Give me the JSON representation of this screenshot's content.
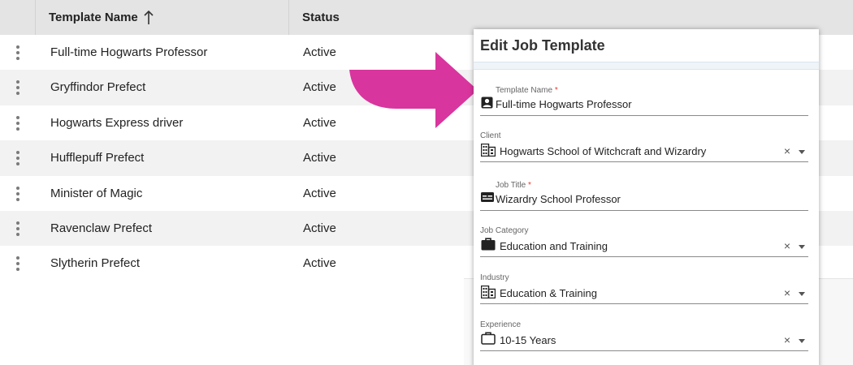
{
  "table": {
    "headers": {
      "name": "Template Name",
      "status": "Status"
    },
    "rows": [
      {
        "name": "Full-time Hogwarts Professor",
        "status": "Active"
      },
      {
        "name": "Gryffindor Prefect",
        "status": "Active"
      },
      {
        "name": "Hogwarts Express driver",
        "status": "Active"
      },
      {
        "name": "Hufflepuff Prefect",
        "status": "Active"
      },
      {
        "name": "Minister of Magic",
        "status": "Active"
      },
      {
        "name": "Ravenclaw Prefect",
        "status": "Active"
      },
      {
        "name": "Slytherin Prefect",
        "status": "Active"
      }
    ]
  },
  "annotation": {
    "arrow_color": "#d9359e"
  },
  "dialog": {
    "title": "Edit Job Template",
    "fields": {
      "template_name": {
        "label": "Template Name",
        "required": "*",
        "value": "Full-time Hogwarts Professor",
        "icon": "person-badge-icon"
      },
      "client": {
        "label": "Client",
        "value": "Hogwarts School of Witchcraft and Wizardry",
        "icon": "building-icon",
        "clear": "×"
      },
      "job_title": {
        "label": "Job Title",
        "required": "*",
        "value": "Wizardry School Professor",
        "icon": "id-card-icon"
      },
      "job_category": {
        "label": "Job Category",
        "value": "Education and Training",
        "icon": "briefcase-icon",
        "clear": "×"
      },
      "industry": {
        "label": "Industry",
        "value": "Education & Training",
        "icon": "building-icon",
        "clear": "×"
      },
      "experience": {
        "label": "Experience",
        "value": "10-15 Years",
        "icon": "briefcase-outline-icon",
        "clear": "×"
      }
    }
  }
}
